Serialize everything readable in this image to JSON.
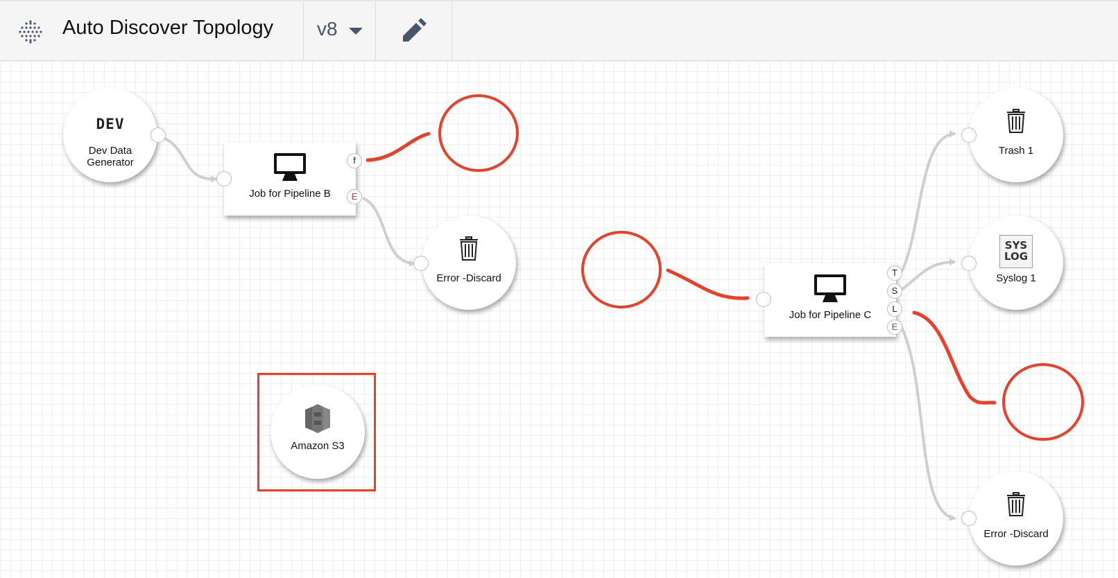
{
  "header": {
    "title": "Auto Discover Topology",
    "version": "v8",
    "logo_icon": "dotted-grid-logo-icon",
    "edit_icon": "pencil-icon",
    "caret_icon": "caret-down-icon"
  },
  "nodes": {
    "dev_generator": {
      "badge": "DEV",
      "label_line1": "Dev Data",
      "label_line2": "Generator"
    },
    "job_b": {
      "label": "Job for Pipeline B",
      "icon": "monitor-icon"
    },
    "error_discard_b": {
      "label": "Error -Discard",
      "icon": "trash-icon"
    },
    "amazon_s3": {
      "label": "Amazon S3",
      "icon": "amazon-s3-icon"
    },
    "job_c": {
      "label": "Job for Pipeline C",
      "icon": "monitor-icon"
    },
    "trash_1": {
      "label": "Trash 1",
      "icon": "trash-icon"
    },
    "syslog_1": {
      "label": "Syslog 1",
      "icon": "syslog-icon",
      "icon_text_line1": "SYS",
      "icon_text_line2": "LOG"
    },
    "error_discard_c": {
      "label": "Error -Discard",
      "icon": "trash-icon"
    }
  },
  "ports": {
    "job_b_out_f": "f",
    "job_b_out_e": "E",
    "job_c_out_t": "T",
    "job_c_out_s": "S",
    "job_c_out_l": "L",
    "job_c_out_e": "E"
  },
  "colors": {
    "annotation": "#e8412a",
    "wire": "#cfcfcf",
    "error_port": "#d9342b",
    "header_bg": "#f5f5f5",
    "version_text": "#47566b"
  }
}
